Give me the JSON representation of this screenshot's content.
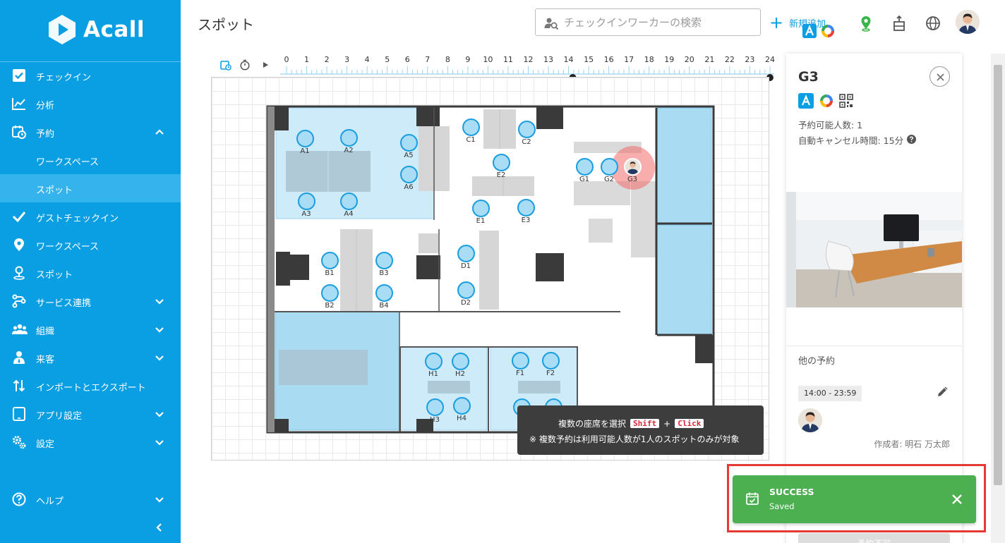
{
  "app": {
    "brand": "Acall",
    "accent": "#0a9ee3"
  },
  "sidebar": {
    "items": [
      {
        "label": "チェックイン",
        "icon": "checkbox-icon"
      },
      {
        "label": "分析",
        "icon": "chart-line-icon"
      },
      {
        "label": "予約",
        "icon": "calendar-clock-icon",
        "expanded": true
      },
      {
        "label": "ワークスペース",
        "sub": true
      },
      {
        "label": "スポット",
        "sub": true,
        "active": true
      },
      {
        "label": "ゲストチェックイン",
        "icon": "check-icon"
      },
      {
        "label": "ワークスペース",
        "icon": "map-pin-icon"
      },
      {
        "label": "スポット",
        "icon": "user-pin-icon"
      },
      {
        "label": "サービス連携",
        "icon": "integration-icon"
      },
      {
        "label": "組織",
        "icon": "people-icon"
      },
      {
        "label": "来客",
        "icon": "visitor-icon"
      },
      {
        "label": "インポートとエクスポート",
        "icon": "import-export-icon"
      },
      {
        "label": "アプリ設定",
        "icon": "tablet-icon"
      },
      {
        "label": "設定",
        "icon": "gears-icon"
      },
      {
        "label": "ヘルプ",
        "icon": "help-circle-icon"
      }
    ]
  },
  "header": {
    "title": "スポット",
    "search_placeholder": "チェックインワーカーの検索",
    "new_label": "新規追加"
  },
  "timeline": {
    "hours": [
      "0",
      "1",
      "2",
      "3",
      "4",
      "5",
      "6",
      "7",
      "8",
      "9",
      "10",
      "11",
      "12",
      "13",
      "14",
      "15",
      "16",
      "17",
      "18",
      "19",
      "20",
      "21",
      "22",
      "23",
      "24"
    ],
    "range_start_hour": 14,
    "range_end_hour": 24
  },
  "floor": {
    "seats": [
      {
        "id": "A1",
        "label": "A1"
      },
      {
        "id": "A2",
        "label": "A2"
      },
      {
        "id": "A3",
        "label": "A3"
      },
      {
        "id": "A4",
        "label": "A4"
      },
      {
        "id": "A5",
        "label": "A5"
      },
      {
        "id": "A6",
        "label": "A6"
      },
      {
        "id": "C1",
        "label": "C1"
      },
      {
        "id": "C2",
        "label": "C2"
      },
      {
        "id": "E2",
        "label": "E2"
      },
      {
        "id": "E1",
        "label": "E1"
      },
      {
        "id": "E3",
        "label": "E3"
      },
      {
        "id": "G1",
        "label": "G1"
      },
      {
        "id": "G2",
        "label": "G2"
      },
      {
        "id": "G3",
        "label": "G3",
        "selected": true
      },
      {
        "id": "B1",
        "label": "B1"
      },
      {
        "id": "B3",
        "label": "B3"
      },
      {
        "id": "B2",
        "label": "B2"
      },
      {
        "id": "B4",
        "label": "B4"
      },
      {
        "id": "D1",
        "label": "D1"
      },
      {
        "id": "D2",
        "label": "D2"
      },
      {
        "id": "H1",
        "label": "H1"
      },
      {
        "id": "H2",
        "label": "H2"
      },
      {
        "id": "H3",
        "label": "H3"
      },
      {
        "id": "H4",
        "label": "H4"
      },
      {
        "id": "F1",
        "label": "F1"
      },
      {
        "id": "F2",
        "label": "F2"
      },
      {
        "id": "F3",
        "label": ""
      },
      {
        "id": "F4",
        "label": ""
      }
    ]
  },
  "tooltip": {
    "line1_prefix": "複数の座席を選択",
    "key1": "Shift",
    "plus": "+",
    "key2": "Click",
    "line2": "※ 複数予約は利用可能人数が1人のスポットのみが対象"
  },
  "panel": {
    "title": "G3",
    "capacity": "予約可能人数: 1",
    "auto_cancel": "自動キャンセル時間: 15分",
    "other_reservations": "他の予約",
    "reservation_time": "14:00 - 23:59",
    "creator": "作成者: 明石 万太郎",
    "button_label": "予約不可"
  },
  "toast": {
    "title": "SUCCESS",
    "message": "Saved",
    "color": "#4caf50"
  }
}
